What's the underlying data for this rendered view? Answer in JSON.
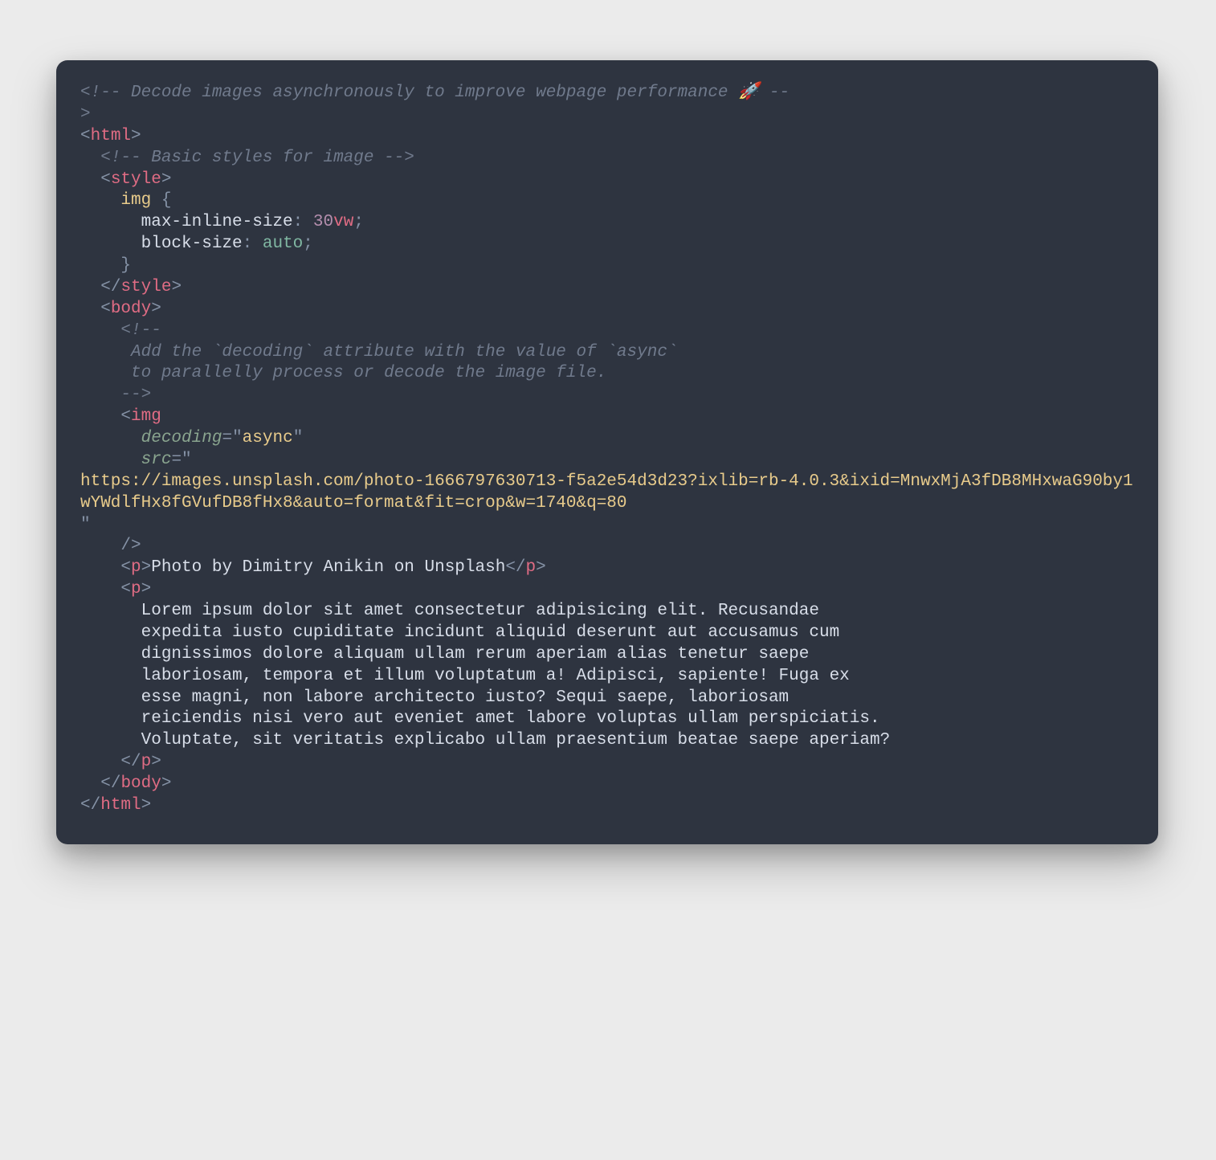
{
  "code": {
    "comment_top_a": "<!-- Decode images asynchronously to improve webpage performance 🚀 --",
    "comment_top_b": ">",
    "tag_html_open_l": "<",
    "tag_html": "html",
    "tag_close_gt": ">",
    "comment_styles": "<!-- Basic styles for image -->",
    "tag_style_open_l": "<",
    "tag_style": "style",
    "css_selector": "img",
    "css_brace_open": " {",
    "css_prop1": "max-inline-size",
    "css_colon": ":",
    "css_space": " ",
    "css_num1": "30",
    "css_unit1": "vw",
    "css_semi": ";",
    "css_prop2": "block-size",
    "css_val2": "auto",
    "css_brace_close": "}",
    "tag_style_close_l": "</",
    "tag_body_open_l": "<",
    "tag_body": "body",
    "comment_block_open": "<!--",
    "comment_block_line1": "Add the `decoding` attribute with the value of `async`",
    "comment_block_line2": "to parallelly process or decode the image file.",
    "comment_block_close": "-->",
    "tag_img_open_l": "<",
    "tag_img": "img",
    "attr_decoding": "decoding",
    "eq": "=",
    "quote": "\"",
    "val_async": "async",
    "attr_src": "src",
    "url": "https://images.unsplash.com/photo-1666797630713-f5a2e54d3d23?ixlib=rb-4.0.3&ixid=MnwxMjA3fDB8MHxwaG90by1wYWdlfHx8fGVufDB8fHx8&auto=format&fit=crop&w=1740&q=80",
    "tag_selfclose": "/>",
    "tag_p_open_l": "<",
    "tag_p": "p",
    "p1_text": "Photo by Dimitry Anikin on Unsplash",
    "tag_p_close_l": "</",
    "lorem_l1": "Lorem ipsum dolor sit amet consectetur adipisicing elit. Recusandae",
    "lorem_l2": "expedita iusto cupiditate incidunt aliquid deserunt aut accusamus cum",
    "lorem_l3": "dignissimos dolore aliquam ullam rerum aperiam alias tenetur saepe",
    "lorem_l4": "laboriosam, tempora et illum voluptatum a! Adipisci, sapiente! Fuga ex",
    "lorem_l5": "esse magni, non labore architecto iusto? Sequi saepe, laboriosam",
    "lorem_l6": "reiciendis nisi vero aut eveniet amet labore voluptas ullam perspiciatis.",
    "lorem_l7": "Voluptate, sit veritatis explicabo ullam praesentium beatae saepe aperiam?",
    "tag_body_close_l": "</",
    "tag_html_close_l": "</"
  }
}
